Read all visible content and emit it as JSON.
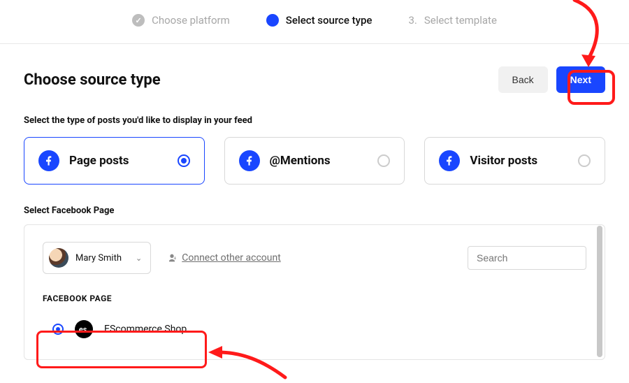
{
  "stepper": {
    "step1": "Choose platform",
    "step2": "Select source type",
    "step3_prefix": "3.",
    "step3": "Select template"
  },
  "header": {
    "title": "Choose source type",
    "back": "Back",
    "next": "Next"
  },
  "prompt1": "Select the type of posts you'd like to display in your feed",
  "options": {
    "page_posts": "Page posts",
    "mentions": "@Mentions",
    "visitor_posts": "Visitor posts"
  },
  "prompt2": "Select Facebook Page",
  "account": {
    "name": "Mary Smith",
    "connect_other": "Connect other account"
  },
  "search": {
    "placeholder": "Search"
  },
  "section_label": "FACEBOOK PAGE",
  "page": {
    "name": "EScommerce Shop",
    "logo_text": "es."
  }
}
